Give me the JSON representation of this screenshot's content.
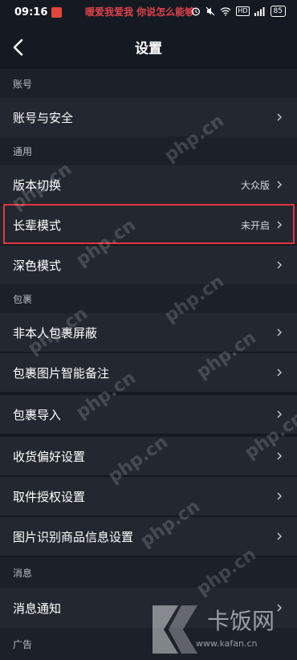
{
  "status_bar": {
    "time": "09:16",
    "message": "暖爱我爱我 你说怎么能够",
    "battery": "85",
    "hd": "HD"
  },
  "nav": {
    "title": "设置"
  },
  "sections": {
    "account": {
      "header": "账号",
      "items": [
        {
          "label": "账号与安全",
          "value": ""
        }
      ]
    },
    "general": {
      "header": "通用",
      "items": [
        {
          "label": "版本切换",
          "value": "大众版"
        },
        {
          "label": "长辈模式",
          "value": "未开启"
        },
        {
          "label": "深色模式",
          "value": ""
        }
      ]
    },
    "package": {
      "header": "包裹",
      "items": [
        {
          "label": "非本人包裹屏蔽",
          "value": ""
        },
        {
          "label": "包裹图片智能备注",
          "value": ""
        },
        {
          "label": "包裹导入",
          "value": ""
        },
        {
          "label": "收货偏好设置",
          "value": ""
        },
        {
          "label": "取件授权设置",
          "value": ""
        },
        {
          "label": "图片识别商品信息设置",
          "value": ""
        }
      ]
    },
    "messages": {
      "header": "消息",
      "items": [
        {
          "label": "消息通知",
          "value": ""
        }
      ]
    },
    "ads": {
      "header": "广告"
    }
  },
  "watermark": {
    "text": "php.cn",
    "brand": "卡饭网",
    "url": "www.kafan.cn"
  },
  "colors": {
    "background": "#151a22",
    "row": "#232830",
    "highlight": "#e2363b",
    "status_message": "#e0424b"
  }
}
